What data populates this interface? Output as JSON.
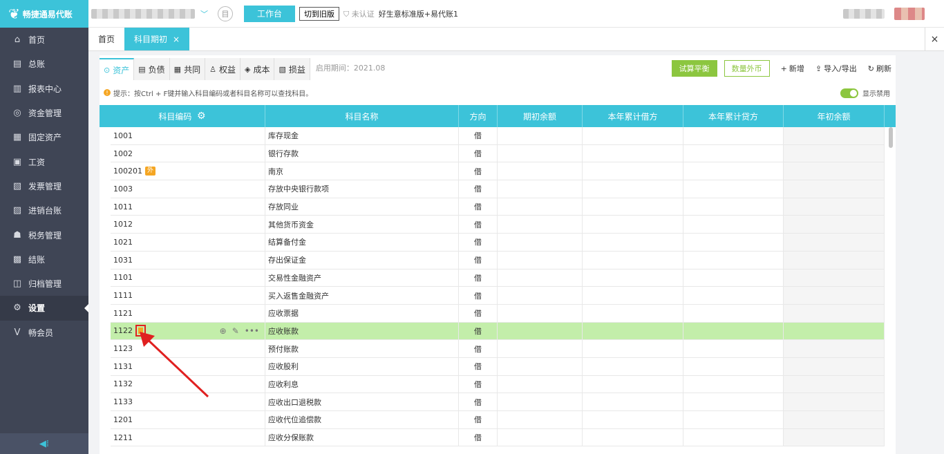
{
  "app": {
    "logo": "畅捷通易代账"
  },
  "sidebar": {
    "items": [
      {
        "label": "首页",
        "icon": "home-icon",
        "glyph": "⌂"
      },
      {
        "label": "总账",
        "icon": "ledger-icon",
        "glyph": "▤"
      },
      {
        "label": "报表中心",
        "icon": "chart-icon",
        "glyph": "▥"
      },
      {
        "label": "资金管理",
        "icon": "money-icon",
        "glyph": "◎"
      },
      {
        "label": "固定资产",
        "icon": "asset-icon",
        "glyph": "▦"
      },
      {
        "label": "工资",
        "icon": "salary-icon",
        "glyph": "▣"
      },
      {
        "label": "发票管理",
        "icon": "invoice-icon",
        "glyph": "▧"
      },
      {
        "label": "进销台账",
        "icon": "inventory-icon",
        "glyph": "▨"
      },
      {
        "label": "税务管理",
        "icon": "tax-icon",
        "glyph": "☗"
      },
      {
        "label": "结账",
        "icon": "close-books-icon",
        "glyph": "▩"
      },
      {
        "label": "归档管理",
        "icon": "archive-icon",
        "glyph": "◫"
      },
      {
        "label": "设置",
        "icon": "gear-icon",
        "glyph": "⚙"
      },
      {
        "label": "畅会员",
        "icon": "vip-icon",
        "glyph": "V"
      }
    ],
    "active_index": 11,
    "collapse_glyph": "◀⁞"
  },
  "topbar": {
    "workbench": "工作台",
    "switch_old": "切到旧版",
    "cert_status": "未认证",
    "plan": "好生意标准版+易代账1"
  },
  "tabs": [
    {
      "label": "首页",
      "active": false
    },
    {
      "label": "科目期初",
      "active": true,
      "close": "×"
    }
  ],
  "tabs_close_all": "×",
  "category_tabs": [
    {
      "label": "资产",
      "glyph": "⊙",
      "active": true
    },
    {
      "label": "负债",
      "glyph": "▤",
      "active": false
    },
    {
      "label": "共同",
      "glyph": "▦",
      "active": false
    },
    {
      "label": "权益",
      "glyph": "♙",
      "active": false
    },
    {
      "label": "成本",
      "glyph": "◈",
      "active": false
    },
    {
      "label": "损益",
      "glyph": "▧",
      "active": false
    }
  ],
  "period": "启用期间：2021.08",
  "toolbar": {
    "trial_balance": "试算平衡",
    "qty_currency": "数量外币",
    "add": "新增",
    "import_export": "导入/导出",
    "refresh": "刷新"
  },
  "hint": "提示：按Ctrl + F键并输入科目编码或者科目名称可以查找科目。",
  "show_disabled": "显示禁用",
  "columns": [
    "科目编码",
    "科目名称",
    "方向",
    "期初余额",
    "本年累计借方",
    "本年累计贷方",
    "年初余额"
  ],
  "rows": [
    {
      "code": "1001",
      "name": "库存现金",
      "dir": "借"
    },
    {
      "code": "1002",
      "name": "银行存款",
      "dir": "借"
    },
    {
      "code": "100201",
      "badge": "外",
      "name": "南京",
      "dir": "借"
    },
    {
      "code": "1003",
      "name": "存放中央银行款项",
      "dir": "借"
    },
    {
      "code": "1011",
      "name": "存放同业",
      "dir": "借"
    },
    {
      "code": "1012",
      "name": "其他货币资金",
      "dir": "借"
    },
    {
      "code": "1021",
      "name": "结算备付金",
      "dir": "借"
    },
    {
      "code": "1031",
      "name": "存出保证金",
      "dir": "借"
    },
    {
      "code": "1101",
      "name": "交易性金融资产",
      "dir": "借"
    },
    {
      "code": "1111",
      "name": "买入返售金融资产",
      "dir": "借"
    },
    {
      "code": "1121",
      "name": "应收票据",
      "dir": "借"
    },
    {
      "code": "1122",
      "name": "应收账款",
      "dir": "借",
      "selected": true
    },
    {
      "code": "1123",
      "name": "预付账款",
      "dir": "借"
    },
    {
      "code": "1131",
      "name": "应收股利",
      "dir": "借"
    },
    {
      "code": "1132",
      "name": "应收利息",
      "dir": "借"
    },
    {
      "code": "1133",
      "name": "应收出口退税款",
      "dir": "借"
    },
    {
      "code": "1201",
      "name": "应收代位追偿款",
      "dir": "借"
    },
    {
      "code": "1211",
      "name": "应收分保账款",
      "dir": "借"
    }
  ]
}
